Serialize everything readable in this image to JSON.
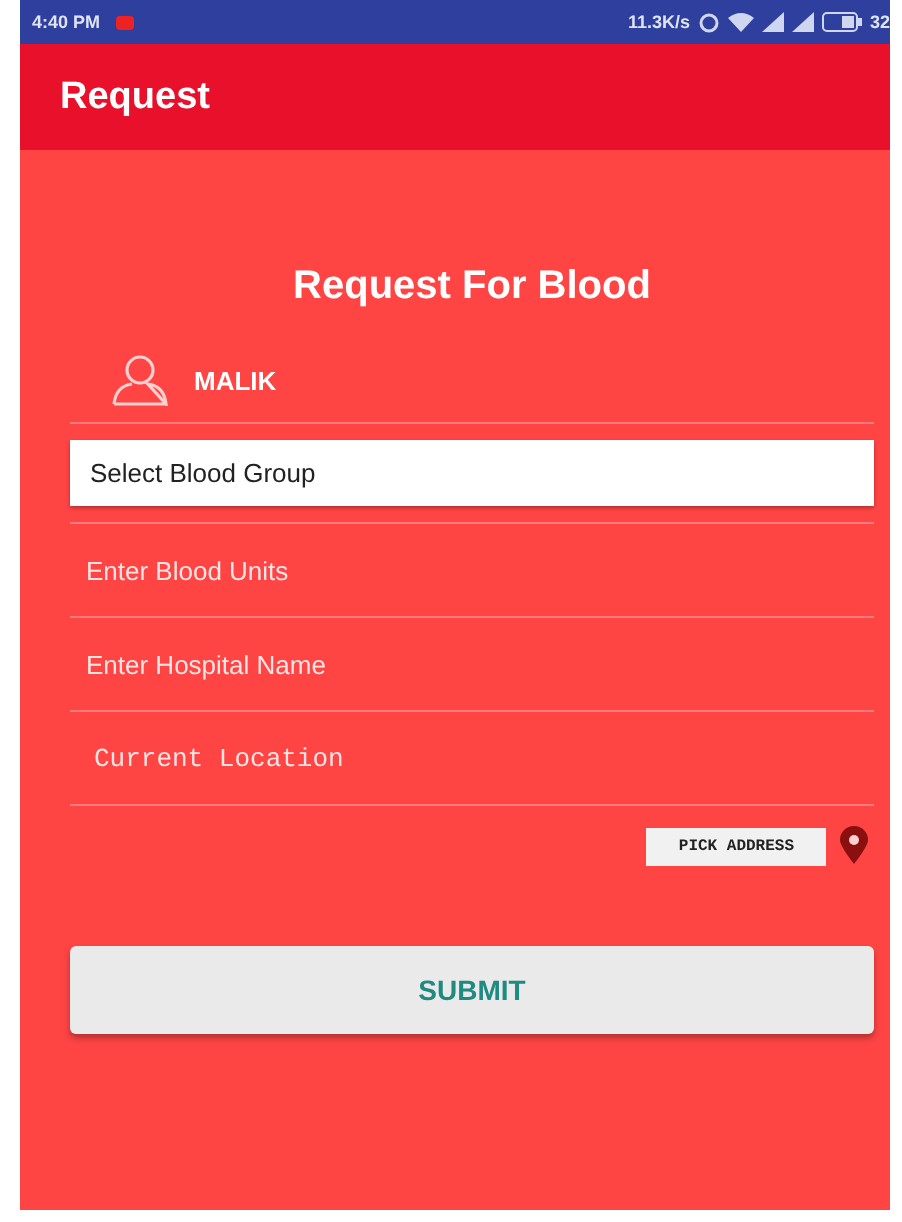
{
  "status_bar": {
    "time": "4:40 PM",
    "speed": "11.3K/s",
    "battery": "32"
  },
  "app_bar": {
    "title": "Request"
  },
  "form": {
    "heading": "Request For Blood",
    "user": "MALIK",
    "fields": [
      {
        "kind": "select",
        "placeholder": "Select Blood Group"
      },
      {
        "kind": "text",
        "placeholder": "Enter Blood Units"
      },
      {
        "kind": "text",
        "placeholder": "Enter Hospital Name"
      },
      {
        "kind": "mono",
        "placeholder": "Current Location"
      }
    ],
    "pick_address": "PICK ADDRESS",
    "submit": "SUBMIT"
  }
}
